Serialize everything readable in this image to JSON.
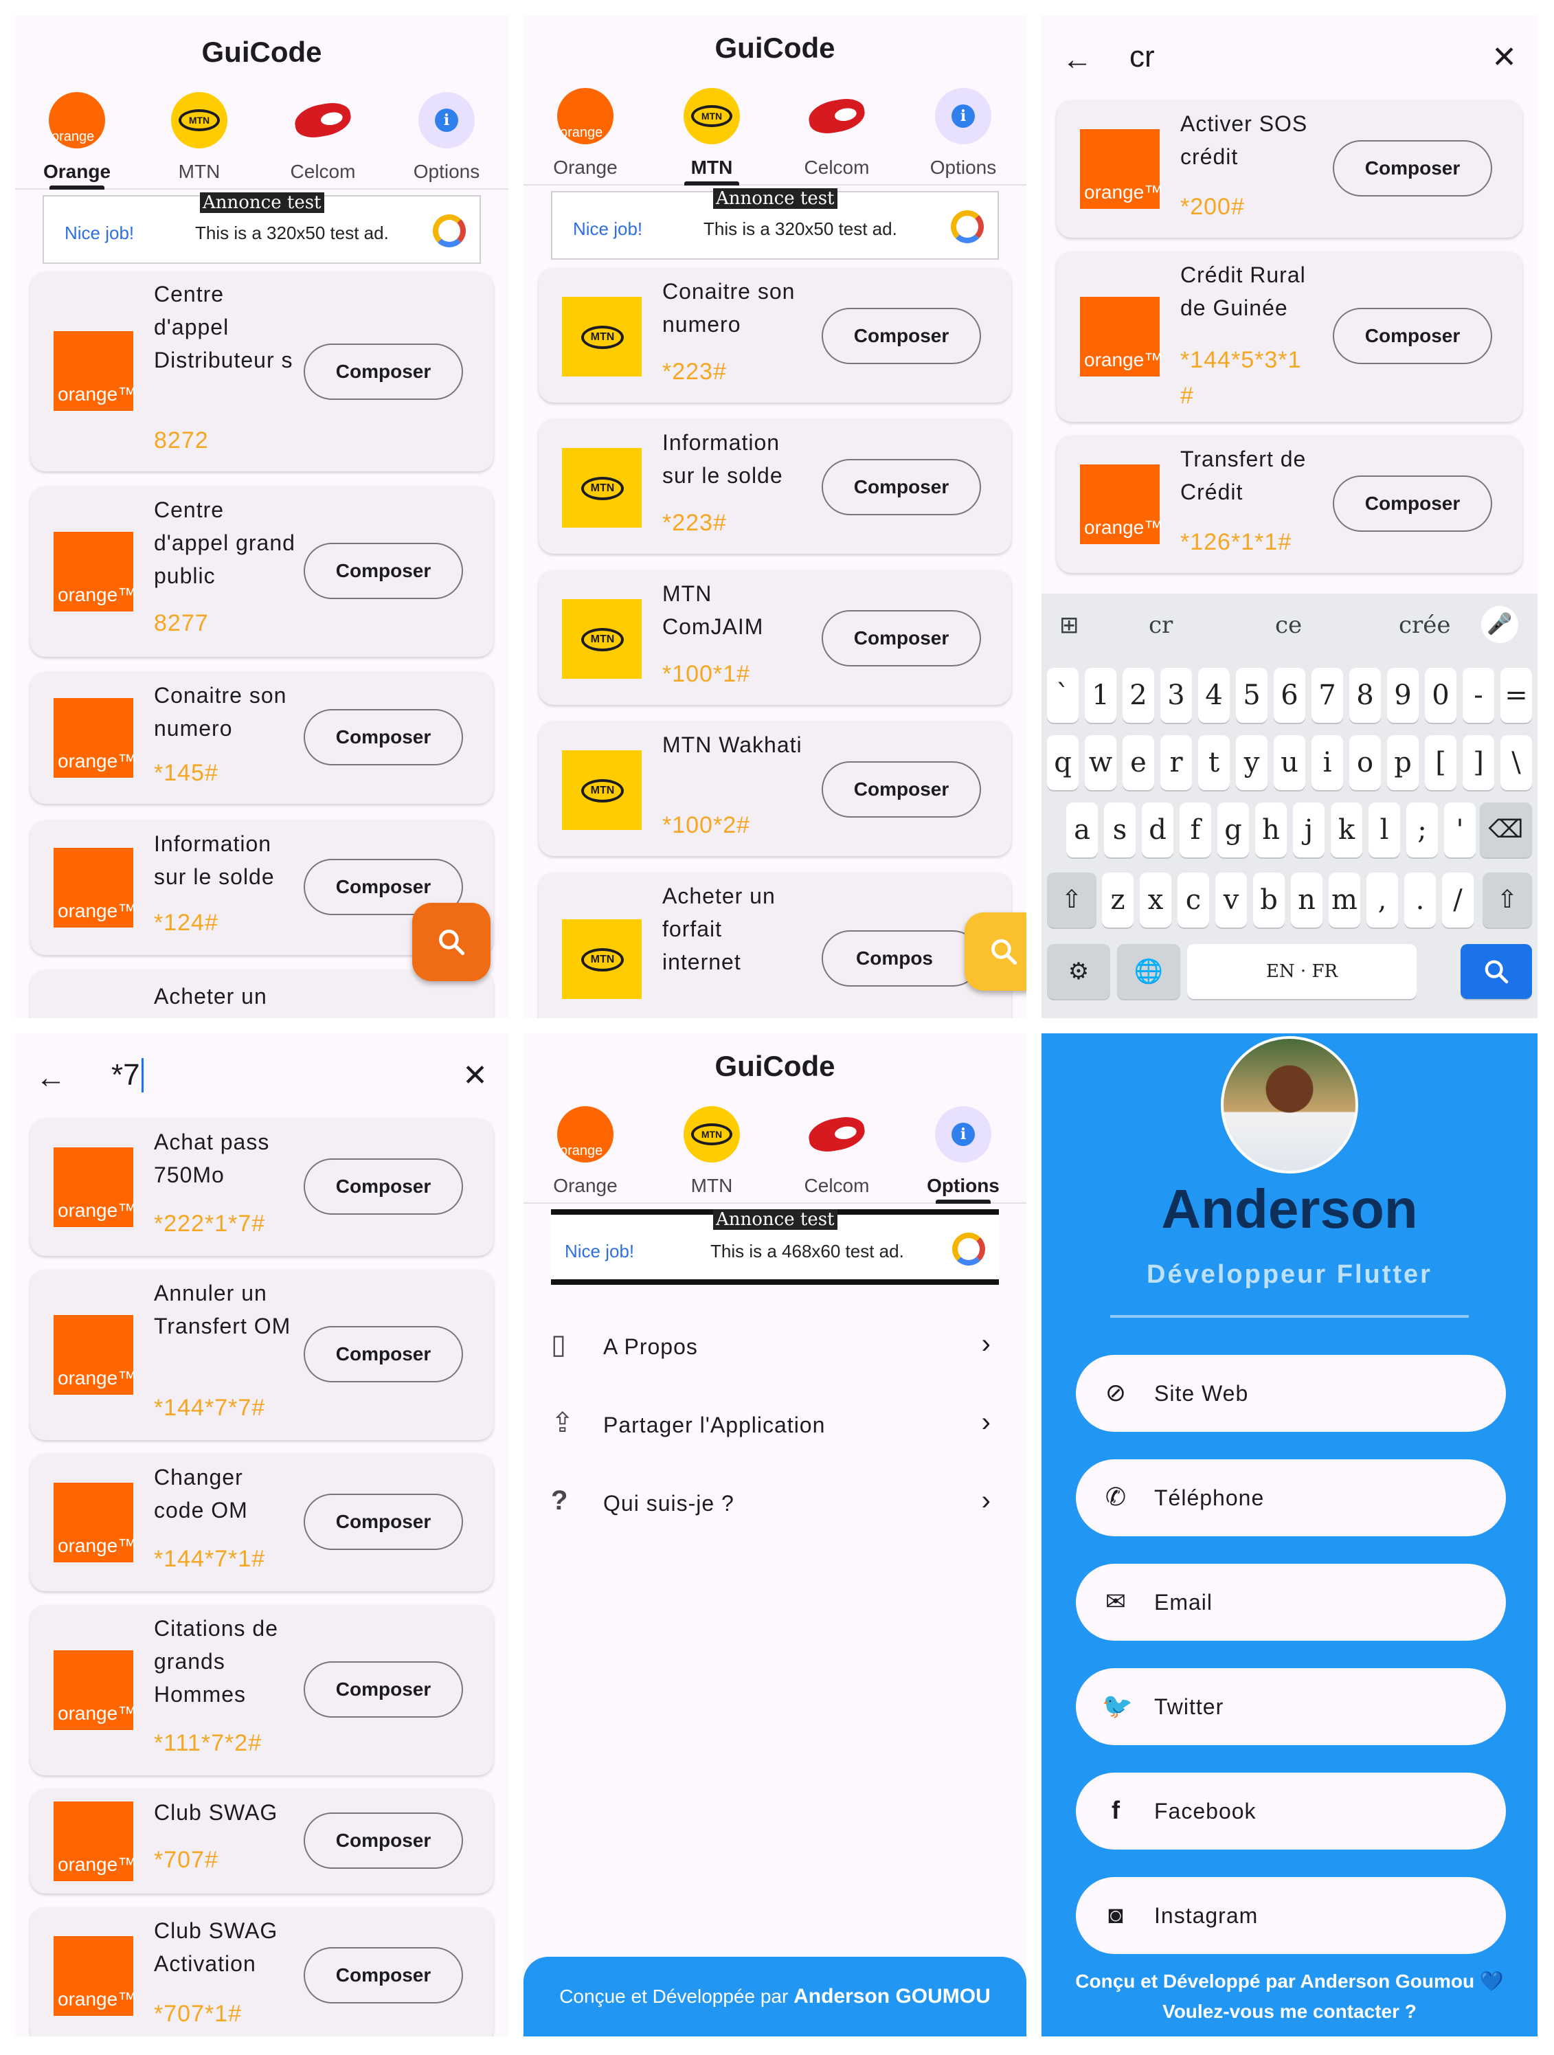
{
  "app": {
    "title": "GuiCode"
  },
  "tabs": [
    "Orange",
    "MTN",
    "Celcom",
    "Options"
  ],
  "tab_icon_text": {
    "orange": "orange",
    "mtn": "MTN"
  },
  "ad": {
    "tag": "Annonce test",
    "nice": "Nice job!",
    "text_small": "This is a 320x50 test ad.",
    "text_large": "This is a 468x60 test ad."
  },
  "brand": {
    "orange": "orange™",
    "mtn": "MTN"
  },
  "compose_label": "Composer",
  "compose_label_cut": "Compos",
  "colors": {
    "orange": "#ff6600",
    "mtn": "#ffcc00",
    "code": "#f5a623",
    "fab_orange": "#f06c14",
    "fab_yellow": "#fbc02d",
    "profile_bg": "#2196f3"
  },
  "panel1": {
    "cards": [
      {
        "title": "Centre d'appel Distributeur s",
        "code": "8272"
      },
      {
        "title": "Centre d'appel grand public",
        "code": "8277"
      },
      {
        "title": "Conaitre son numero",
        "code": "*145#"
      },
      {
        "title": "Information sur le solde",
        "code": "*124#"
      },
      {
        "title": "Acheter un",
        "code": ""
      }
    ]
  },
  "panel2": {
    "cards": [
      {
        "title": "Conaitre son numero",
        "code": "*223#"
      },
      {
        "title": "Information sur le solde",
        "code": "*223#"
      },
      {
        "title": "MTN ComJAIM",
        "code": "*100*1#"
      },
      {
        "title": "MTN Wakhati",
        "code": "*100*2#"
      },
      {
        "title": "Acheter un forfait internet",
        "code": ""
      }
    ]
  },
  "panel3": {
    "query": "cr",
    "cards": [
      {
        "title": "Activer SOS crédit",
        "code": "*200#"
      },
      {
        "title": "Crédit Rural de Guinée",
        "code": "*144*5*3*1 #"
      },
      {
        "title": "Transfert de Crédit",
        "code": "*126*1*1#"
      }
    ],
    "suggestions": [
      "cr",
      "ce",
      "crée"
    ],
    "keys_row1": [
      "`",
      "1",
      "2",
      "3",
      "4",
      "5",
      "6",
      "7",
      "8",
      "9",
      "0",
      "-",
      "="
    ],
    "keys_row2": [
      "q",
      "w",
      "e",
      "r",
      "t",
      "y",
      "u",
      "i",
      "o",
      "p",
      "[",
      "]",
      "\\"
    ],
    "keys_row3": [
      "a",
      "s",
      "d",
      "f",
      "g",
      "h",
      "j",
      "k",
      "l",
      ";",
      "'"
    ],
    "keys_row4": [
      "z",
      "x",
      "c",
      "v",
      "b",
      "n",
      "m",
      ",",
      ".",
      "/"
    ],
    "space_label": "EN · FR"
  },
  "panel4": {
    "query": "*7",
    "cards": [
      {
        "title": "Achat pass 750Mo",
        "code": "*222*1*7#"
      },
      {
        "title": "Annuler un Transfert OM",
        "code": "*144*7*7#"
      },
      {
        "title": "Changer code OM",
        "code": "*144*7*1#"
      },
      {
        "title": "Citations de grands Hommes",
        "code": "*111*7*2#"
      },
      {
        "title": "Club SWAG",
        "code": "*707#"
      },
      {
        "title": "Club SWAG Activation",
        "code": "*707*1#"
      }
    ]
  },
  "panel5": {
    "options": [
      {
        "label": "A Propos",
        "icon": "info-phone-icon"
      },
      {
        "label": "Partager l'Application",
        "icon": "share-icon"
      },
      {
        "label": "Qui suis-je ?",
        "icon": "question-icon"
      }
    ],
    "footer_prefix": "Conçue et Développée par",
    "footer_name": "Anderson GOUMOU"
  },
  "panel6": {
    "name": "Anderson",
    "role": "Développeur Flutter",
    "contacts": [
      {
        "label": "Site Web",
        "icon": "link-icon"
      },
      {
        "label": "Téléphone",
        "icon": "phone-icon"
      },
      {
        "label": "Email",
        "icon": "email-icon"
      },
      {
        "label": "Twitter",
        "icon": "twitter-icon"
      },
      {
        "label": "Facebook",
        "icon": "facebook-icon"
      },
      {
        "label": "Instagram",
        "icon": "instagram-icon"
      }
    ],
    "footer_line1": "Conçu et Développé par Anderson Goumou 💙",
    "footer_line2": "Voulez-vous me contacter ?"
  }
}
